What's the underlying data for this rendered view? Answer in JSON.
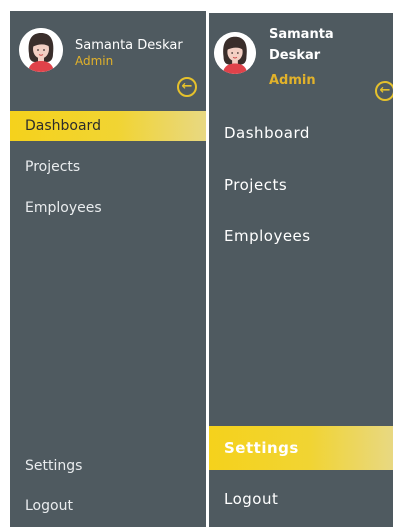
{
  "sidebar_expanded": {
    "user": {
      "name": "Samanta Deskar",
      "role": "Admin"
    },
    "collapse_icon": "arrow-left-circle-icon",
    "nav": [
      {
        "label": "Dashboard",
        "active": true
      },
      {
        "label": "Projects",
        "active": false
      },
      {
        "label": "Employees",
        "active": false
      }
    ],
    "bottom_nav": [
      {
        "label": "Settings",
        "active": false
      },
      {
        "label": "Logout",
        "active": false
      }
    ]
  },
  "sidebar_variant": {
    "user": {
      "name": "Samanta Deskar",
      "role": "Admin"
    },
    "collapse_icon": "arrow-left-circle-icon",
    "nav": [
      {
        "label": "Dashboard",
        "active": false
      },
      {
        "label": "Projects",
        "active": false
      },
      {
        "label": "Employees",
        "active": false
      }
    ],
    "bottom_nav": [
      {
        "label": "Settings",
        "active": true
      },
      {
        "label": "Logout",
        "active": false
      }
    ]
  },
  "colors": {
    "panel_bg": "#4f5a60",
    "accent_yellow": "#f5d21c",
    "role_gold": "#e2b22a"
  }
}
